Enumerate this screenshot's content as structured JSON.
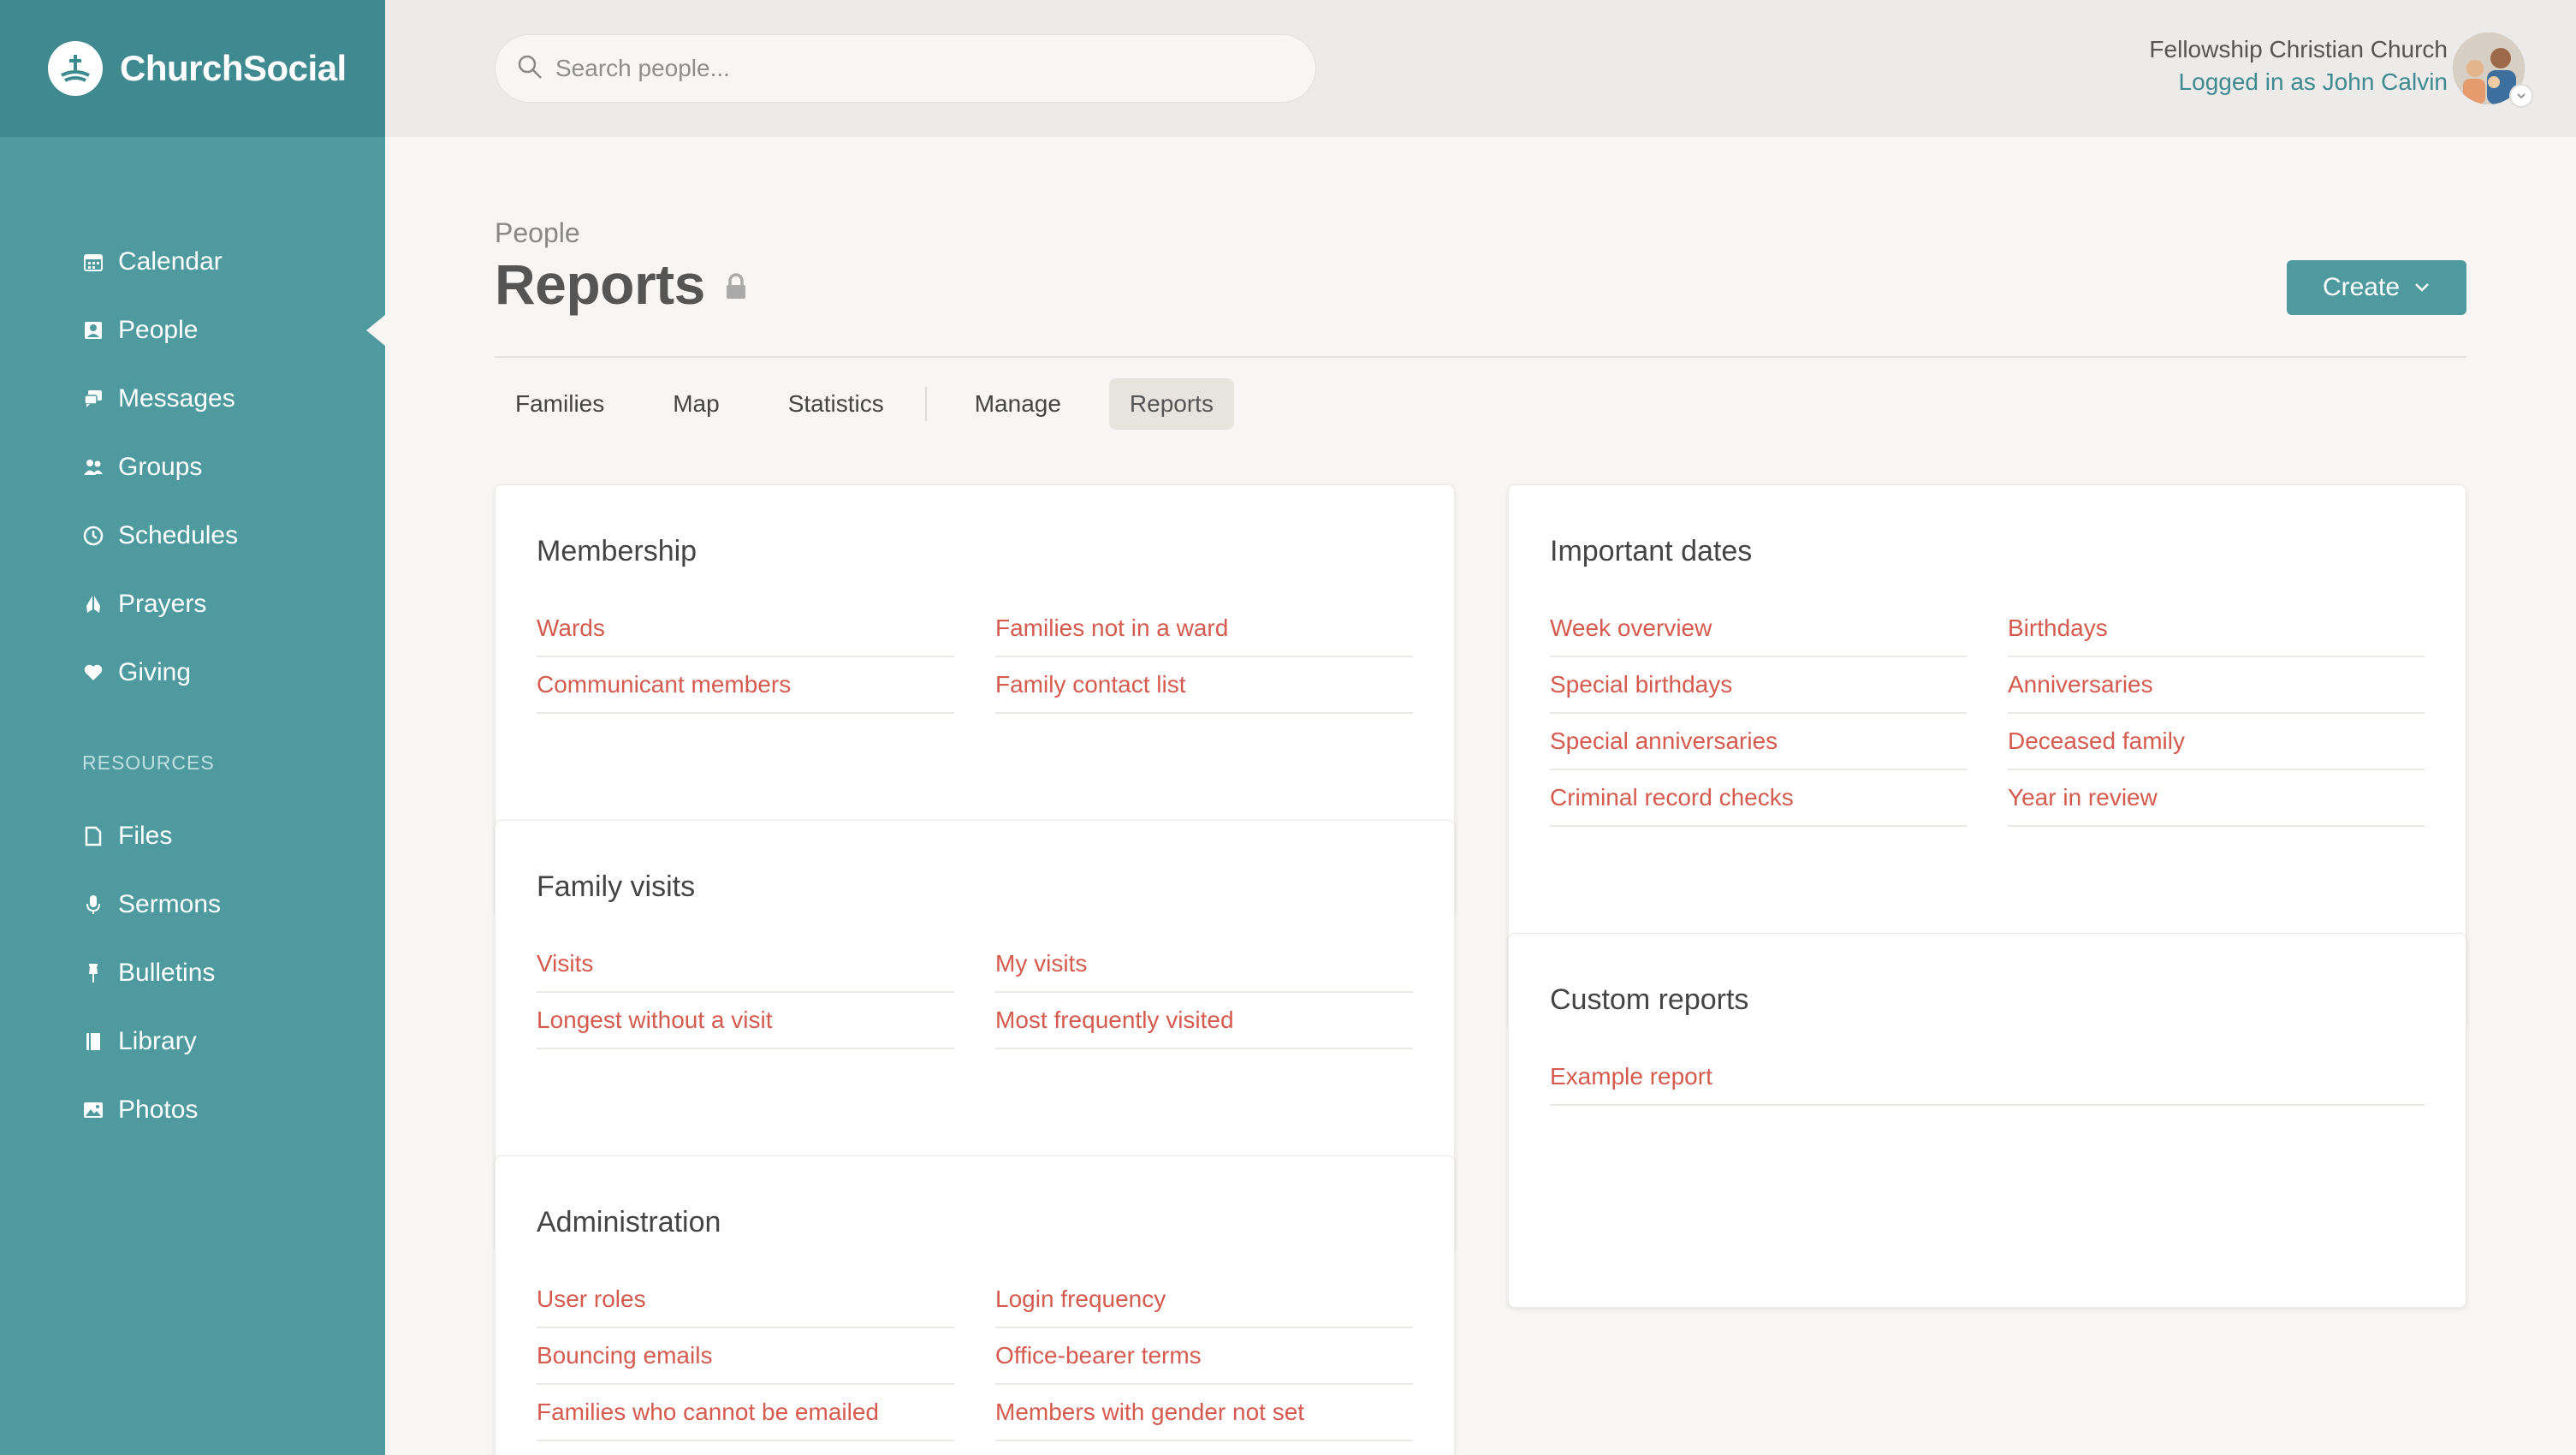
{
  "brand": {
    "name": "ChurchSocial"
  },
  "sidebar": {
    "items": [
      {
        "label": "Calendar",
        "icon": "calendar-icon"
      },
      {
        "label": "People",
        "icon": "people-icon",
        "active": true
      },
      {
        "label": "Messages",
        "icon": "messages-icon"
      },
      {
        "label": "Groups",
        "icon": "groups-icon"
      },
      {
        "label": "Schedules",
        "icon": "clock-icon"
      },
      {
        "label": "Prayers",
        "icon": "praying-hands-icon"
      },
      {
        "label": "Giving",
        "icon": "heart-icon"
      }
    ],
    "resources_label": "RESOURCES",
    "resources": [
      {
        "label": "Files",
        "icon": "file-icon"
      },
      {
        "label": "Sermons",
        "icon": "microphone-icon"
      },
      {
        "label": "Bulletins",
        "icon": "pin-icon"
      },
      {
        "label": "Library",
        "icon": "book-icon"
      },
      {
        "label": "Photos",
        "icon": "photo-icon"
      }
    ]
  },
  "header": {
    "search_placeholder": "Search people...",
    "org_name": "Fellowship Christian Church",
    "logged_in": "Logged in as John Calvin"
  },
  "page": {
    "breadcrumb": "People",
    "title": "Reports",
    "create_label": "Create",
    "tabs": [
      "Families",
      "Map",
      "Statistics",
      "Manage",
      "Reports"
    ],
    "active_tab": "Reports"
  },
  "cards": {
    "membership": {
      "title": "Membership",
      "links": [
        "Wards",
        "Families not in a ward",
        "Communicant members",
        "Family contact list"
      ]
    },
    "family_visits": {
      "title": "Family visits",
      "links": [
        "Visits",
        "My visits",
        "Longest without a visit",
        "Most frequently visited"
      ]
    },
    "administration": {
      "title": "Administration",
      "links": [
        "User roles",
        "Login frequency",
        "Bouncing emails",
        "Office-bearer terms",
        "Families who cannot be emailed",
        "Members with gender not set"
      ]
    },
    "important_dates": {
      "title": "Important dates",
      "links": [
        "Week overview",
        "Birthdays",
        "Special birthdays",
        "Anniversaries",
        "Special anniversaries",
        "Deceased family",
        "Criminal record checks",
        "Year in review"
      ]
    },
    "custom_reports": {
      "title": "Custom reports",
      "links": [
        "Example report"
      ]
    }
  },
  "colors": {
    "sidebar": "#4f9a9f",
    "brand_bar": "#3e8a90",
    "link": "#d55b4f",
    "accent": "#4f9a9f"
  }
}
